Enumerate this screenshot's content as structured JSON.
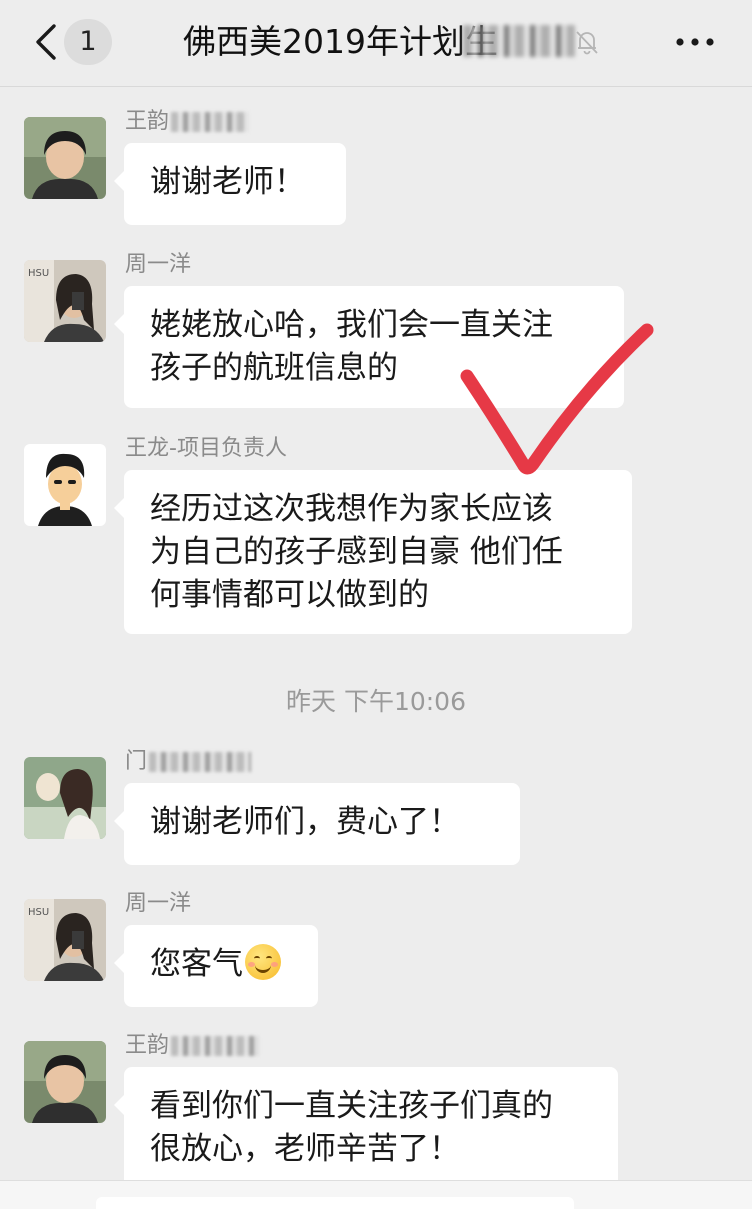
{
  "header": {
    "unread_count": "1",
    "title": "佛西美2019年计划生"
  },
  "messages": [
    {
      "sender": "王韵",
      "text_lines": [
        "谢谢老师！"
      ]
    },
    {
      "sender": "周一洋",
      "text_lines": [
        "姥姥放心哈，我们会一直关注",
        "孩子的航班信息的"
      ]
    },
    {
      "sender": "王龙-项目负责人",
      "text_lines": [
        "经历过这次我想作为家长应该",
        "为自己的孩子感到自豪 他们任",
        "何事情都可以做到的"
      ]
    },
    {
      "sender": "门",
      "text_lines": [
        "谢谢老师们，费心了！"
      ]
    },
    {
      "sender": "周一洋",
      "text": "您客气",
      "emoji": "smiling-face-emoji"
    },
    {
      "sender": "王韵",
      "text_lines": [
        "看到你们一直关注孩子们真的",
        "很放心，老师辛苦了！"
      ]
    }
  ],
  "timestamp": "昨天 下午10:06",
  "colors": {
    "background": "#ededed",
    "bubble": "#ffffff",
    "name_text": "#8a8a8a",
    "checkmark": "#e63946"
  },
  "icons": [
    "back-arrow-icon",
    "mute-bell-icon",
    "more-dots-icon",
    "checkmark-annotation"
  ]
}
